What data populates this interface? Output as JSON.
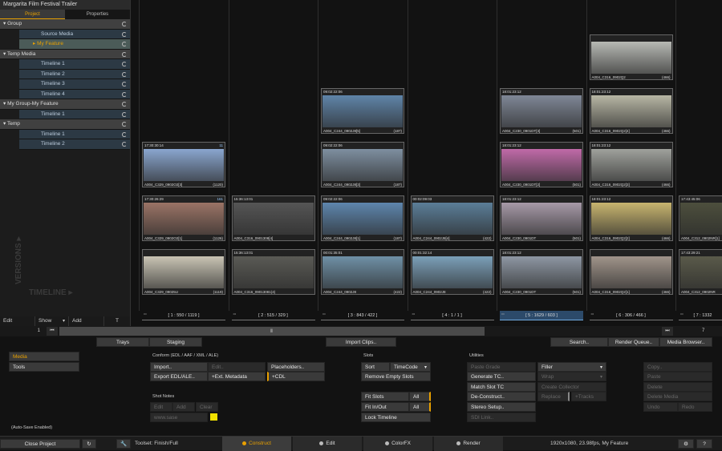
{
  "project": {
    "title": "Margarita Film Festival Trailer",
    "tabs": [
      "Project",
      "Properties"
    ]
  },
  "tree": [
    {
      "label": "Group",
      "type": "grp"
    },
    {
      "label": "Source Media",
      "type": "sub"
    },
    {
      "label": "My Feature",
      "type": "sel"
    },
    {
      "label": "Temp Media",
      "type": "grp"
    },
    {
      "label": "Timeline 1",
      "type": "sub"
    },
    {
      "label": "Timeline 2",
      "type": "sub"
    },
    {
      "label": "Timeline 3",
      "type": "sub"
    },
    {
      "label": "Timeline 4",
      "type": "sub"
    },
    {
      "label": "My Group-My Feature",
      "type": "grp"
    },
    {
      "label": "Timeline 1",
      "type": "sub"
    },
    {
      "label": "Temp",
      "type": "grp"
    },
    {
      "label": "Timeline 1",
      "type": "sub"
    },
    {
      "label": "Timeline 2",
      "type": "sub"
    }
  ],
  "side_labels": {
    "versions": "VERSIONS ▸",
    "timeline": "TIMELINE ▸"
  },
  "left_bottom": {
    "edit": "Edit",
    "show": "Show",
    "add": "Add",
    "t": "T"
  },
  "scrubber": {
    "start": "1",
    "end": "7"
  },
  "tracks": [
    {
      "label": "[ 1 : 550 / 1119 ]",
      "clips": [
        {
          "tc": "17:30:30:14",
          "meta": "11",
          "name": "A004_C329_0902O2[3]",
          "count": "(1120)",
          "img": "#8aa6cf"
        },
        {
          "tc": "17:30:26:29",
          "meta": "161",
          "name": "A004_C329_0902O2[1]",
          "count": "(1126)",
          "img": "#9b7466"
        },
        {
          "tc": "",
          "meta": "",
          "name": "A004_C329_09025U",
          "count": "(1119)",
          "img": "#c9c4b4"
        }
      ]
    },
    {
      "label": "[ 2 : 515 / 329 ]",
      "clips": [
        {
          "tc": "15:36:13:01",
          "meta": "",
          "name": "A004_C316_0901308[4]",
          "count": "",
          "img": "#555"
        },
        {
          "tc": "15:36:13:01",
          "meta": "",
          "name": "A004_C316_09013081(4)",
          "count": "",
          "img": "#5a5a55"
        }
      ]
    },
    {
      "label": "[ 3 : 843 / 422 ]",
      "clips": [
        {
          "tc": "09:02:22:06",
          "meta": "",
          "name": "A004_C244_0902J8[5]",
          "count": "(187)",
          "img": "#5f84a8"
        },
        {
          "tc": "09:02:22:06",
          "meta": "",
          "name": "A004_C244_0902J8[3]",
          "count": "(187)",
          "img": "#7e8fa0"
        },
        {
          "tc": "09:02:22:06",
          "meta": "",
          "name": "A004_C244_0902J8[1]",
          "count": "(187)",
          "img": "#5e86ad"
        },
        {
          "tc": "00:01:35:01",
          "meta": "",
          "name": "A004_C244_0902J8",
          "count": "(422)",
          "img": "#6f90a6"
        }
      ]
    },
    {
      "label": "[ 4 : 1 / 1 ]",
      "clips": [
        {
          "tc": "00:02:09:03",
          "meta": "",
          "name": "A004_C244_0902J8[4]",
          "count": "(422)",
          "img": "#5b7e98"
        },
        {
          "tc": "00:01:32:14",
          "meta": "",
          "name": "A004_C244_0902J8",
          "count": "(422)",
          "img": "#7b9fb8"
        }
      ]
    },
    {
      "label": "[ 5 : 1629 / 603 ]",
      "clips": [
        {
          "tc": "18:01:23:12",
          "meta": "",
          "name": "A004_C230_0901DT[3]",
          "count": "(501)",
          "img": "#7f8796"
        },
        {
          "tc": "18:01:23:12",
          "meta": "",
          "name": "A004_C230_0901DT[2]",
          "count": "(501)",
          "img": "#c06aa8"
        },
        {
          "tc": "18:01:23:12",
          "meta": "",
          "name": "A004_C230_0901DT",
          "count": "(501)",
          "img": "#a79aa8"
        },
        {
          "tc": "18:01:23:12",
          "meta": "",
          "name": "A004_C230_0901DT",
          "count": "(501)",
          "img": "#8e97a3"
        }
      ]
    },
    {
      "label": "[ 6 : 306 / 466 ]",
      "clips": [
        {
          "tc": "",
          "meta": "",
          "name": "A004_C316_0902Q2",
          "count": "(466)",
          "img": "#b7b9b4"
        },
        {
          "tc": "18:01:23:12",
          "meta": "",
          "name": "A004_C316_0902Q2[4]",
          "count": "(466)",
          "img": "#b7b6a4"
        },
        {
          "tc": "18:01:23:12",
          "meta": "",
          "name": "A004_C316_0902Q2[3]",
          "count": "(466)",
          "img": "#9fa19c"
        },
        {
          "tc": "18:01:23:12",
          "meta": "",
          "name": "A004_C316_0902Q2[2]",
          "count": "(466)",
          "img": "#c8b56f"
        },
        {
          "tc": "",
          "meta": "",
          "name": "A004_C316_0902Q2[1]",
          "count": "(466)",
          "img": "#a0948a"
        }
      ]
    },
    {
      "label": "[ 7 : 1332",
      "clips": [
        {
          "tc": "17:43:45:06",
          "meta": "",
          "name": "A004_C312_0902NR[1]",
          "count": "",
          "img": "#4d4f3d"
        },
        {
          "tc": "17:43:29:21",
          "meta": "",
          "name": "A004_C312_0902NR",
          "count": "",
          "img": "#5a5a4a"
        }
      ]
    }
  ],
  "toolbar": {
    "trays": "Trays",
    "staging": "Staging",
    "import_clips": "Import Clips..",
    "search": "Search..",
    "render_queue": "Render Queue..",
    "media_browser": "Media Browser.."
  },
  "left_menu": {
    "media": "Media",
    "tools": "Tools",
    "autosave": "(Auto-Save Enabled)"
  },
  "conform": {
    "title": "Conform (EDL / AAF / XML / ALE)",
    "import": "Import..",
    "edit": "Edit..",
    "placeholders": "Placeholders..",
    "export": "Export EDL/ALE..",
    "ext_metadata": "+Ext. Metadata",
    "cdl": "+CDL"
  },
  "shot_notes": {
    "title": "Shot Notes",
    "edit": "Edit",
    "add": "Add",
    "clear": "Clear",
    "placeholder": "www.sase"
  },
  "slots": {
    "title": "Slots",
    "sort": "Sort",
    "timecode": "TimeCode",
    "remove_empty": "Remove Empty Slots",
    "fit_slots": "Fit Slots",
    "fit_in_out": "Fit In/Out",
    "all1": "All",
    "all2": "All",
    "lock_timeline": "Lock Timeline"
  },
  "utilities": {
    "title": "Utilities",
    "paste_grade": "Paste Grade",
    "generate_tc": "Generate TC..",
    "match_slot_tc": "Match Slot TC",
    "de_construct": "De-Construct..",
    "stereo_setup": "Stereo Setup..",
    "sdi_link": "SDI Link..",
    "filler": "Filler",
    "wrap": "Wrap",
    "create_collector": "Create Collector",
    "replace": "Replace",
    "tracks": "+Tracks"
  },
  "edit_ops": {
    "copy": "Copy..",
    "paste": "Paste",
    "delete": "Delete",
    "delete_media": "Delete Media",
    "undo": "Undo",
    "redo": "Redo"
  },
  "footer": {
    "close_project": "Close Project",
    "toolset": "Toolset: Finish/Full",
    "construct": "Construct",
    "edit": "Edit",
    "colorfx": "ColorFX",
    "render": "Render",
    "format": "1920x1080, 23.98fps, My Feature",
    "help": "?"
  },
  "colors": {
    "accent": "#e8a000",
    "selected_track": "#2c4a6a"
  }
}
